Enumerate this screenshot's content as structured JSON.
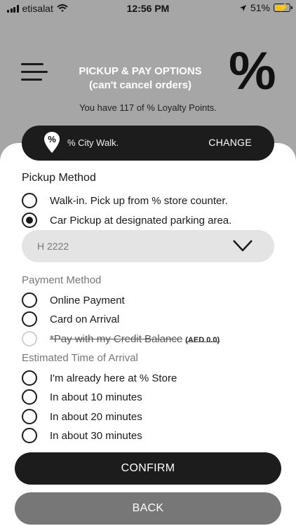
{
  "status_bar": {
    "carrier": "etisalat",
    "time": "12:56 PM",
    "battery_percent": "51%",
    "battery_level": 0.51,
    "icons": [
      "signal-icon",
      "wifi-icon",
      "location-arrow-icon",
      "battery-charging-icon"
    ]
  },
  "header": {
    "title_line1": "PICKUP & PAY OPTIONS",
    "title_line2": "(can't cancel orders)",
    "logo_text": "%",
    "loyalty_text": "You have 117 of % Loyalty Points."
  },
  "location": {
    "pin_symbol": "%",
    "name": "% City Walk.",
    "change_label": "CHANGE"
  },
  "pickup": {
    "title": "Pickup Method",
    "options": [
      {
        "label": "Walk-in. Pick up from % store counter.",
        "selected": false
      },
      {
        "label": "Car Pickup at designated parking area.",
        "selected": true
      }
    ],
    "plate_value": "H 2222"
  },
  "payment": {
    "title": "Payment Method",
    "options": [
      {
        "label": "Online Payment",
        "selected": false
      },
      {
        "label": "Card on Arrival",
        "selected": false
      },
      {
        "label": "*Pay with my Credit Balance",
        "balance": "(AED 0.0)",
        "disabled": true
      }
    ]
  },
  "eta": {
    "title": "Estimated Time of Arrival",
    "options": [
      {
        "label": "I'm already here at % Store",
        "selected": false
      },
      {
        "label": "In about 10 minutes",
        "selected": false
      },
      {
        "label": "In about 20 minutes",
        "selected": false
      },
      {
        "label": "In about 30 minutes",
        "selected": false
      }
    ]
  },
  "buttons": {
    "confirm": "CONFIRM",
    "back": "BACK"
  },
  "colors": {
    "header_bg": "#a6a6a6",
    "dark": "#1c1c1c",
    "back_button": "#777777",
    "input_bg": "#e4e4e4",
    "battery_fill": "#f4c400"
  }
}
